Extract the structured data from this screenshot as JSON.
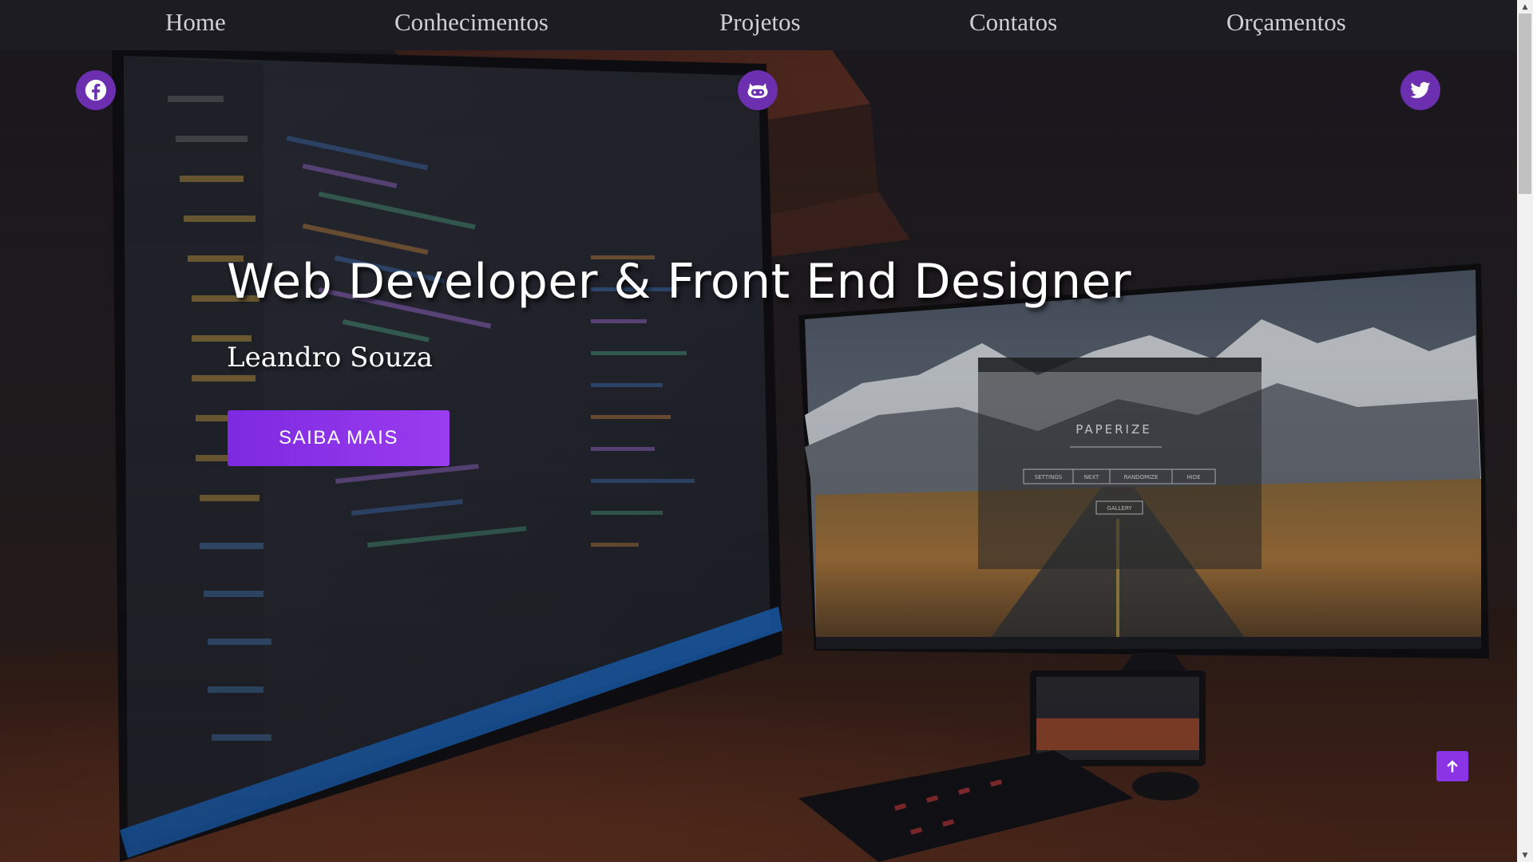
{
  "nav": {
    "items": [
      {
        "label": "Home"
      },
      {
        "label": "Conhecimentos"
      },
      {
        "label": "Projetos"
      },
      {
        "label": "Contatos"
      },
      {
        "label": "Orçamentos"
      }
    ]
  },
  "social": {
    "facebook_icon": "facebook-icon",
    "github_icon": "github-icon",
    "twitter_icon": "twitter-icon"
  },
  "hero": {
    "title": "Web Developer & Front End Designer",
    "subtitle": "Leandro Souza",
    "cta_label": "SAIBA MAIS"
  },
  "background_monitor": {
    "app_title": "PAPERIZE",
    "buttons": [
      "SETTINGS",
      "NEXT",
      "RANDOMIZE",
      "HIDE"
    ],
    "gallery_label": "GALLERY"
  },
  "back_to_top_icon": "arrow-up-icon",
  "colors": {
    "accent": "#8a34e6",
    "nav_bg": "#1d1c22",
    "nav_text": "#cfcfd4",
    "social_bg": "#6b2fb0"
  }
}
